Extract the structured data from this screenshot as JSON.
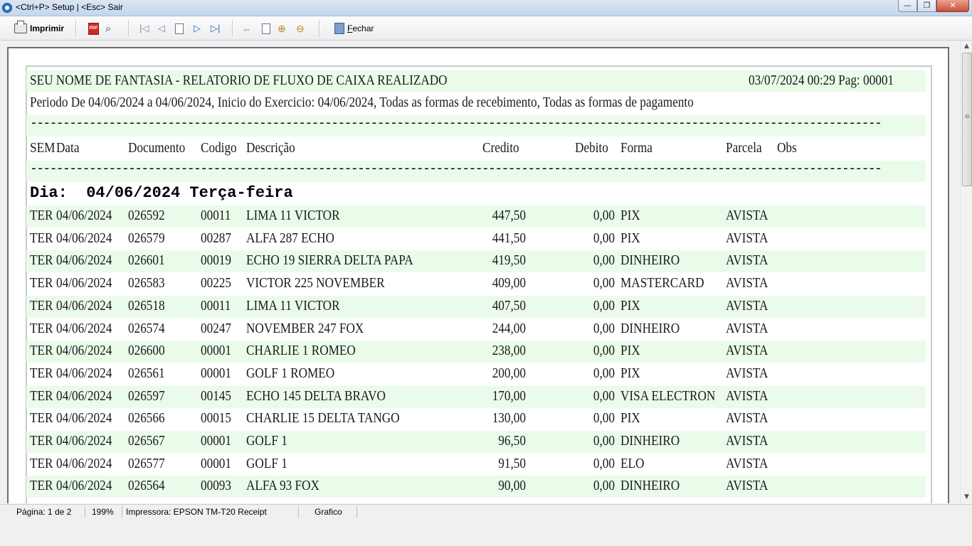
{
  "window": {
    "title": "<Ctrl+P> Setup | <Esc> Sair",
    "buttons": {
      "minimize": "—",
      "maximize": "❐",
      "close": "✕"
    }
  },
  "toolbar": {
    "print_label": "Imprimir",
    "close_label": "Fechar"
  },
  "report": {
    "company_title": "SEU NOME DE FANTASIA - RELATORIO DE FLUXO DE CAIXA REALIZADO",
    "datetime_page": "03/07/2024 00:29 Pag: 00001",
    "period_line": "Periodo De 04/06/2024 a 04/06/2024, Inicio do Exercicio: 04/06/2024, Todas as formas de recebimento, Todas as formas de pagamento",
    "separator": "----------------------------------------------------------------------------------------------------------------------------------",
    "columns": {
      "sem": "SEM",
      "data": "Data",
      "documento": "Documento",
      "codigo": "Codigo",
      "descricao": "Descrição",
      "credito": "Credito",
      "debito": "Debito",
      "forma": "Forma",
      "parcela": "Parcela",
      "obs": "Obs"
    },
    "day_header": "Dia:  04/06/2024 Terça-feira",
    "rows": [
      {
        "sem": "TER",
        "data": "04/06/2024",
        "doc": "026592",
        "cod": "00011",
        "desc": "LIMA 11 VICTOR",
        "cred": "447,50",
        "deb": "0,00",
        "forma": "PIX",
        "parcela": "AVISTA"
      },
      {
        "sem": "TER",
        "data": "04/06/2024",
        "doc": "026579",
        "cod": "00287",
        "desc": "ALFA 287 ECHO",
        "cred": "441,50",
        "deb": "0,00",
        "forma": "PIX",
        "parcela": "AVISTA"
      },
      {
        "sem": "TER",
        "data": "04/06/2024",
        "doc": "026601",
        "cod": "00019",
        "desc": "ECHO 19 SIERRA DELTA PAPA",
        "cred": "419,50",
        "deb": "0,00",
        "forma": "DINHEIRO",
        "parcela": "AVISTA"
      },
      {
        "sem": "TER",
        "data": "04/06/2024",
        "doc": "026583",
        "cod": "00225",
        "desc": "VICTOR 225 NOVEMBER",
        "cred": "409,00",
        "deb": "0,00",
        "forma": "MASTERCARD",
        "parcela": "AVISTA"
      },
      {
        "sem": "TER",
        "data": "04/06/2024",
        "doc": "026518",
        "cod": "00011",
        "desc": "LIMA 11 VICTOR",
        "cred": "407,50",
        "deb": "0,00",
        "forma": "PIX",
        "parcela": "AVISTA"
      },
      {
        "sem": "TER",
        "data": "04/06/2024",
        "doc": "026574",
        "cod": "00247",
        "desc": "NOVEMBER 247 FOX",
        "cred": "244,00",
        "deb": "0,00",
        "forma": "DINHEIRO",
        "parcela": "AVISTA"
      },
      {
        "sem": "TER",
        "data": "04/06/2024",
        "doc": "026600",
        "cod": "00001",
        "desc": "CHARLIE 1 ROMEO",
        "cred": "238,00",
        "deb": "0,00",
        "forma": "PIX",
        "parcela": "AVISTA"
      },
      {
        "sem": "TER",
        "data": "04/06/2024",
        "doc": "026561",
        "cod": "00001",
        "desc": "GOLF 1 ROMEO",
        "cred": "200,00",
        "deb": "0,00",
        "forma": "PIX",
        "parcela": "AVISTA"
      },
      {
        "sem": "TER",
        "data": "04/06/2024",
        "doc": "026597",
        "cod": "00145",
        "desc": "ECHO 145 DELTA BRAVO",
        "cred": "170,00",
        "deb": "0,00",
        "forma": "VISA ELECTRON",
        "parcela": "AVISTA"
      },
      {
        "sem": "TER",
        "data": "04/06/2024",
        "doc": "026566",
        "cod": "00015",
        "desc": "CHARLIE 15 DELTA TANGO",
        "cred": "130,00",
        "deb": "0,00",
        "forma": "PIX",
        "parcela": "AVISTA"
      },
      {
        "sem": "TER",
        "data": "04/06/2024",
        "doc": "026567",
        "cod": "00001",
        "desc": "GOLF 1",
        "cred": "96,50",
        "deb": "0,00",
        "forma": "DINHEIRO",
        "parcela": "AVISTA"
      },
      {
        "sem": "TER",
        "data": "04/06/2024",
        "doc": "026577",
        "cod": "00001",
        "desc": "GOLF 1",
        "cred": "91,50",
        "deb": "0,00",
        "forma": "ELO",
        "parcela": "AVISTA"
      },
      {
        "sem": "TER",
        "data": "04/06/2024",
        "doc": "026564",
        "cod": "00093",
        "desc": "ALFA 93 FOX",
        "cred": "90,00",
        "deb": "0,00",
        "forma": "DINHEIRO",
        "parcela": "AVISTA"
      }
    ]
  },
  "statusbar": {
    "page": "Página: 1 de 2",
    "zoom": "199%",
    "printer": "Impressora: EPSON TM-T20 Receipt",
    "mode": "Grafico"
  },
  "colors": {
    "band_green": "#eafbea",
    "titlebar": "#dbe6f4",
    "close_red": "#c75039"
  }
}
